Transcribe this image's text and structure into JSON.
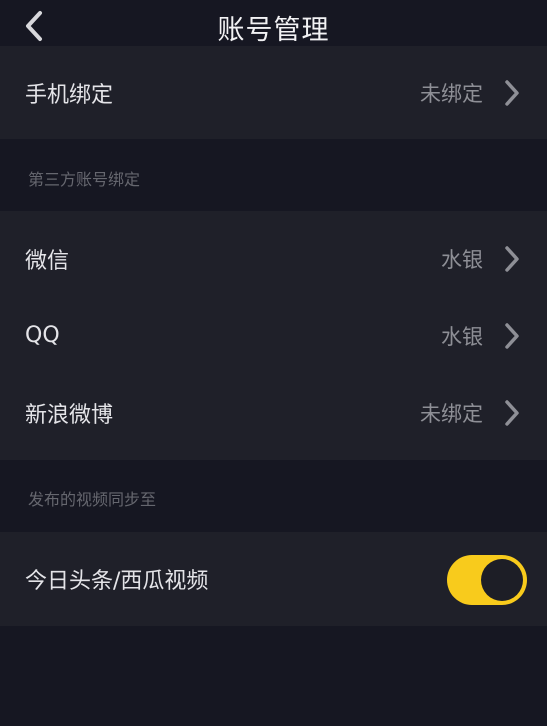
{
  "header": {
    "title": "账号管理",
    "back_icon": "chevron-left-icon"
  },
  "phone": {
    "label": "手机绑定",
    "value": "未绑定"
  },
  "third_party": {
    "section_label": "第三方账号绑定",
    "items": [
      {
        "label": "微信",
        "value": "水银"
      },
      {
        "label": "QQ",
        "value": "水银"
      },
      {
        "label": "新浪微博",
        "value": "未绑定"
      }
    ]
  },
  "sync": {
    "section_label": "发布的视频同步至",
    "item": {
      "label": "今日头条/西瓜视频",
      "toggle_on": true
    }
  },
  "colors": {
    "background": "#161722",
    "card": "#1f2029",
    "toggle_on": "#f8cb1c"
  }
}
